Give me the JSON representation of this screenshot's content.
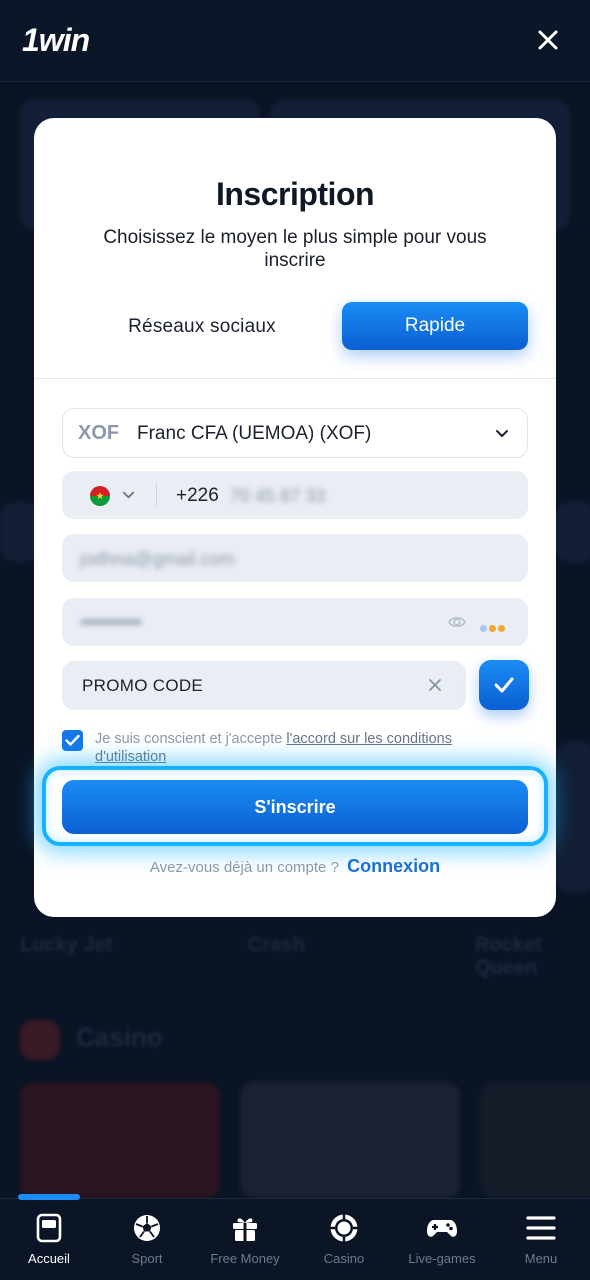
{
  "header": {
    "logo_text": "1win"
  },
  "background": {
    "games": [
      "Lucky Jet",
      "Crash",
      "Rocket Queen"
    ],
    "section_title": "Casino"
  },
  "modal": {
    "title": "Inscription",
    "subtitle": "Choisissez le moyen le plus simple pour vous inscrire",
    "tabs": {
      "social_label": "Réseaux sociaux",
      "quick_label": "Rapide",
      "active": "Rapide"
    },
    "currency": {
      "code": "XOF",
      "name": "Franc CFA (UEMOA) (XOF)"
    },
    "phone": {
      "country_flag": "burkina-faso-flag",
      "prefix": "+226",
      "number_blurred": "70 45 87 33"
    },
    "email": {
      "value_blurred": "jodhna@gmail.com"
    },
    "password": {
      "value_blurred": "••••••••••••••"
    },
    "promo": {
      "value": "PROMO CODE"
    },
    "terms": {
      "checked": true,
      "text": "Je suis conscient et j'accepte ",
      "link_text": "l'accord sur les conditions d'utilisation"
    },
    "submit_label": "S'inscrire",
    "login_prompt": "Avez-vous déjà un compte ?",
    "login_link": "Connexion"
  },
  "bottom_nav": {
    "items": [
      {
        "label": "Accueil",
        "icon": "home-icon",
        "active": true
      },
      {
        "label": "Sport",
        "icon": "soccer-ball-icon",
        "active": false
      },
      {
        "label": "Free Money",
        "icon": "gift-icon",
        "active": false
      },
      {
        "label": "Casino",
        "icon": "casino-chip-icon",
        "active": false
      },
      {
        "label": "Live-games",
        "icon": "gamepad-icon",
        "active": false
      },
      {
        "label": "Menu",
        "icon": "hamburger-icon",
        "active": false
      }
    ]
  },
  "colors": {
    "accent": "#1576e8",
    "glow": "#17b2ff",
    "background": "#0a1425"
  }
}
